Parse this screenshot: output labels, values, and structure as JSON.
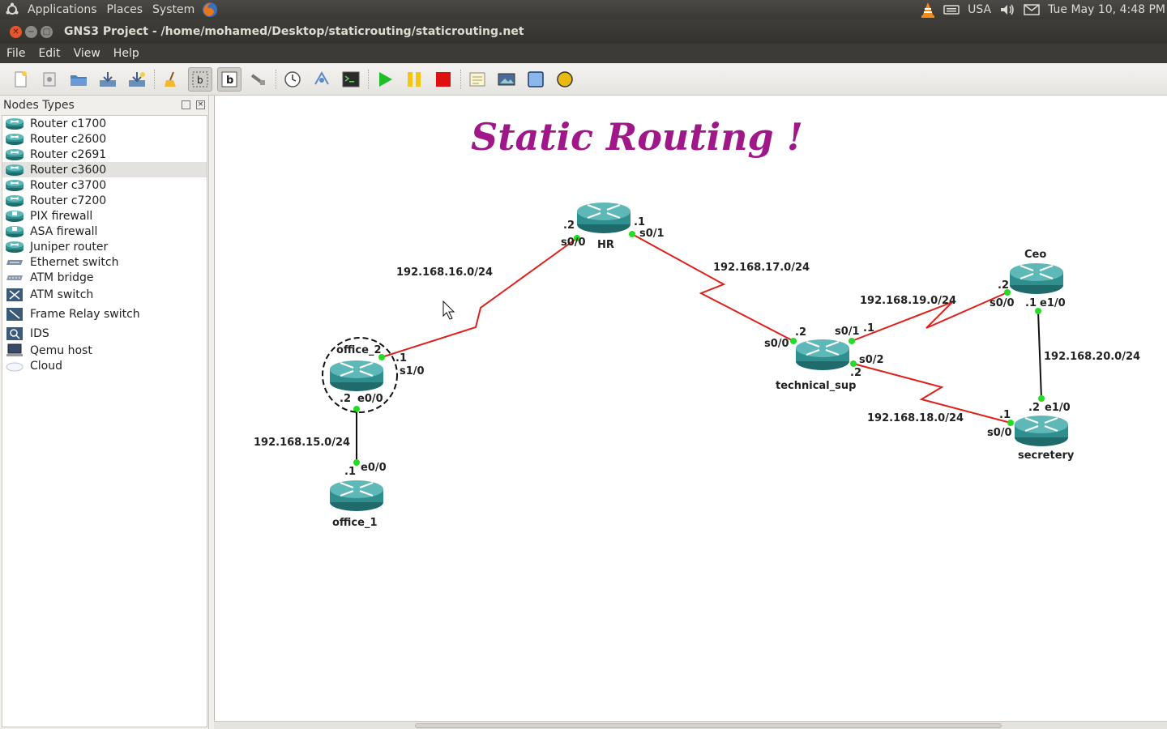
{
  "top_panel": {
    "menus": [
      "Applications",
      "Places",
      "System"
    ],
    "keyboard": "USA",
    "clock": "Tue May 10,  4:48 PM"
  },
  "window": {
    "title": "GNS3 Project - /home/mohamed/Desktop/staticrouting/staticrouting.net"
  },
  "menubar": {
    "file": "File",
    "edit": "Edit",
    "view": "View",
    "help": "Help"
  },
  "dock": {
    "title": "Nodes Types",
    "items": [
      {
        "label": "Router c1700",
        "icon": "router-icon"
      },
      {
        "label": "Router c2600",
        "icon": "router-icon"
      },
      {
        "label": "Router c2691",
        "icon": "router-icon"
      },
      {
        "label": "Router c3600",
        "icon": "router-icon",
        "selected": true
      },
      {
        "label": "Router c3700",
        "icon": "router-icon"
      },
      {
        "label": "Router c7200",
        "icon": "router-icon"
      },
      {
        "label": "PIX firewall",
        "icon": "firewall-icon"
      },
      {
        "label": "ASA firewall",
        "icon": "firewall-icon"
      },
      {
        "label": "Juniper router",
        "icon": "router-icon"
      },
      {
        "label": "Ethernet switch",
        "icon": "switch-icon"
      },
      {
        "label": "ATM bridge",
        "icon": "bridge-icon"
      },
      {
        "label": "ATM switch",
        "icon": "atm-switch-icon"
      },
      {
        "label": "Frame Relay switch",
        "icon": "frame-relay-icon"
      },
      {
        "label": "IDS",
        "icon": "ids-icon"
      },
      {
        "label": "Qemu host",
        "icon": "host-icon"
      },
      {
        "label": "Cloud",
        "icon": "cloud-icon"
      }
    ]
  },
  "topology": {
    "title": "Static Routing !",
    "routers": {
      "hr": "HR",
      "office_2": "office_2",
      "office_1": "office_1",
      "technical_sup": "technical_sup",
      "ceo": "Ceo",
      "secretery": "secretery"
    },
    "networks": {
      "n16": "192.168.16.0/24",
      "n17": "192.168.17.0/24",
      "n15": "192.168.15.0/24",
      "n19": "192.168.19.0/24",
      "n20": "192.168.20.0/24",
      "n18": "192.168.18.0/24"
    },
    "ports": {
      "hr_s00": "s0/0",
      "hr_s01": "s0/1",
      "hr_ip_left": ".2",
      "hr_ip_right": ".1",
      "off2_s10": "s1/0",
      "off2_ip_s10": ".1",
      "off2_e00": "e0/0",
      "off2_ip_e00": ".2",
      "off1_e00": "e0/0",
      "off1_ip": ".1",
      "tech_s00": "s0/0",
      "tech_ip_s00": ".2",
      "tech_s01": "s0/1",
      "tech_ip_s01": ".1",
      "tech_s02": "s0/2",
      "tech_ip_s02": ".2",
      "ceo_s00": "s0/0",
      "ceo_ip_s00": ".2",
      "ceo_e10": "e1/0",
      "ceo_ip_e10": ".1",
      "sec_e10": "e1/0",
      "sec_ip_e10": ".2",
      "sec_s00": "s0/0",
      "sec_ip_s00": ".1"
    },
    "colors": {
      "serial_link": "#e0201a",
      "ethernet_link": "#111111",
      "port_dot": "#22dd22",
      "router_body": "#2f8f8f",
      "title": "#a0178a"
    }
  }
}
